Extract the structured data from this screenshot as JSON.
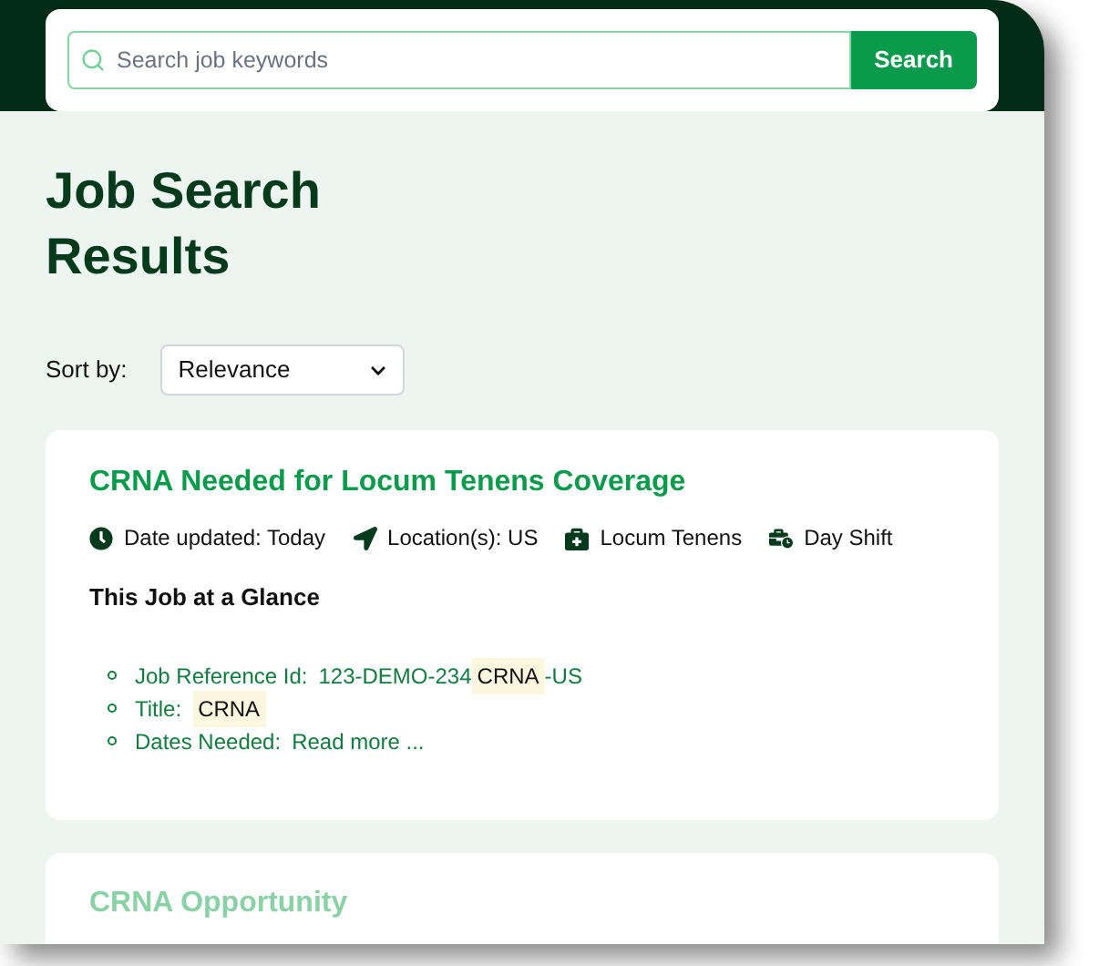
{
  "search": {
    "placeholder": "Search job keywords",
    "button": "Search"
  },
  "heading": [
    "Job Search",
    "Results"
  ],
  "sort": {
    "label": "Sort by:",
    "value": "Relevance"
  },
  "jobs": [
    {
      "title": "CRNA Needed for Locum Tenens Coverage",
      "faded": false,
      "meta": [
        {
          "kind": "clock",
          "text": "Date updated: Today"
        },
        {
          "kind": "location",
          "text": "Location(s): US"
        },
        {
          "kind": "medkit",
          "text": "Locum Tenens"
        },
        {
          "kind": "shift",
          "text": "Day Shift"
        }
      ],
      "glance_title": "This Job at a Glance",
      "fields": [
        {
          "label": "Job Reference Id:",
          "value": [
            {
              "text": "123-DEMO-234",
              "highlighted": false
            },
            {
              "text": "CRNA",
              "highlighted": true
            },
            {
              "text": "-US",
              "highlighted": false
            }
          ]
        },
        {
          "label": "Title:",
          "value": [
            {
              "text": "CRNA",
              "highlighted": true
            }
          ]
        },
        {
          "label": "Dates Needed:",
          "value": [
            {
              "text": "Read more ...",
              "highlighted": false
            }
          ]
        }
      ]
    },
    {
      "title": "CRNA Opportunity",
      "faded": true
    }
  ]
}
